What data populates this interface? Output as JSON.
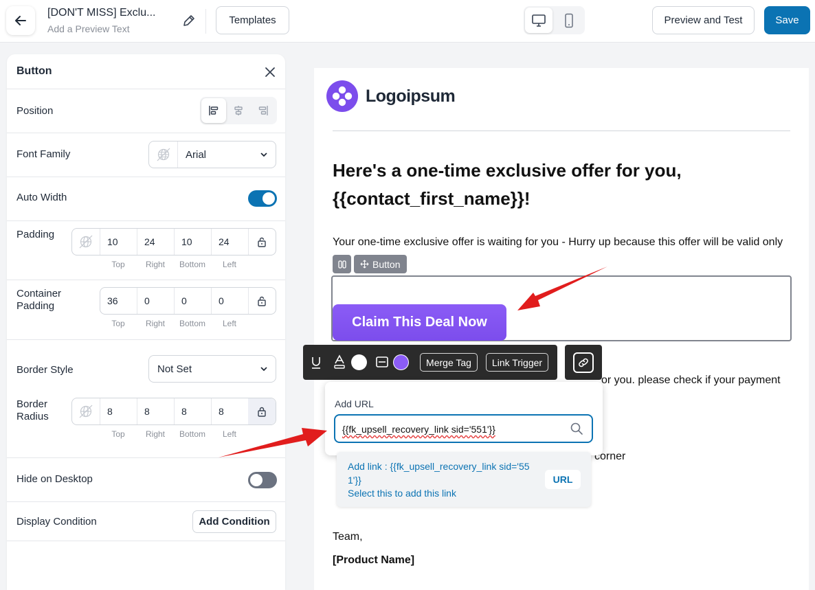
{
  "topbar": {
    "title": "[DON'T MISS] Exclu...",
    "subtitle": "Add a Preview Text",
    "templates_label": "Templates",
    "preview_label": "Preview and Test",
    "save_label": "Save",
    "device_active": "desktop"
  },
  "panel": {
    "title": "Button",
    "position": {
      "label": "Position",
      "active": "left"
    },
    "font_family": {
      "label": "Font Family",
      "value": "Arial"
    },
    "auto_width": {
      "label": "Auto Width",
      "on": true
    },
    "padding": {
      "label": "Padding",
      "values": [
        "10",
        "24",
        "10",
        "24"
      ],
      "caps": [
        "Top",
        "Right",
        "Bottom",
        "Left"
      ]
    },
    "container_padding": {
      "label_1": "Container",
      "label_2": "Padding",
      "values": [
        "36",
        "0",
        "0",
        "0"
      ],
      "caps": [
        "Top",
        "Right",
        "Bottom",
        "Left"
      ]
    },
    "border_style": {
      "label": "Border Style",
      "value": "Not Set"
    },
    "border_radius": {
      "label_1": "Border",
      "label_2": "Radius",
      "values": [
        "8",
        "8",
        "8",
        "8"
      ],
      "caps": [
        "Top",
        "Right",
        "Bottom",
        "Left"
      ]
    },
    "hide_desktop": {
      "label": "Hide on Desktop",
      "on": false
    },
    "display_condition": {
      "label": "Display Condition",
      "button": "Add Condition"
    }
  },
  "email": {
    "logo_text": "Logoipsum",
    "headline_1": "Here's a one-time exclusive offer for you,",
    "headline_2": "{{contact_first_name}}!",
    "para_1": "Your one-time exclusive offer is waiting for you - Hurry up because this offer will be valid only",
    "tag_label": "Button",
    "cta": "Claim This Deal Now",
    "para_2": "or you. please check if your payment",
    "para_3": "corner",
    "signoff": "Team,",
    "product": "[Product Name]"
  },
  "toolbar": {
    "merge_tag": "Merge Tag",
    "link_trigger": "Link Trigger"
  },
  "url_popup": {
    "label": "Add URL",
    "value": "{{fk_upsell_recovery_link sid='551'}}",
    "suggestion_1": "Add link : {{fk_upsell_recovery_link sid='55",
    "suggestion_2": "1'}}",
    "suggestion_hint": "Select this to add this link",
    "suggestion_badge": "URL"
  },
  "colors": {
    "primary": "#0b73b3",
    "cta": "#7c4dec",
    "annotation": "#e11d1d"
  }
}
